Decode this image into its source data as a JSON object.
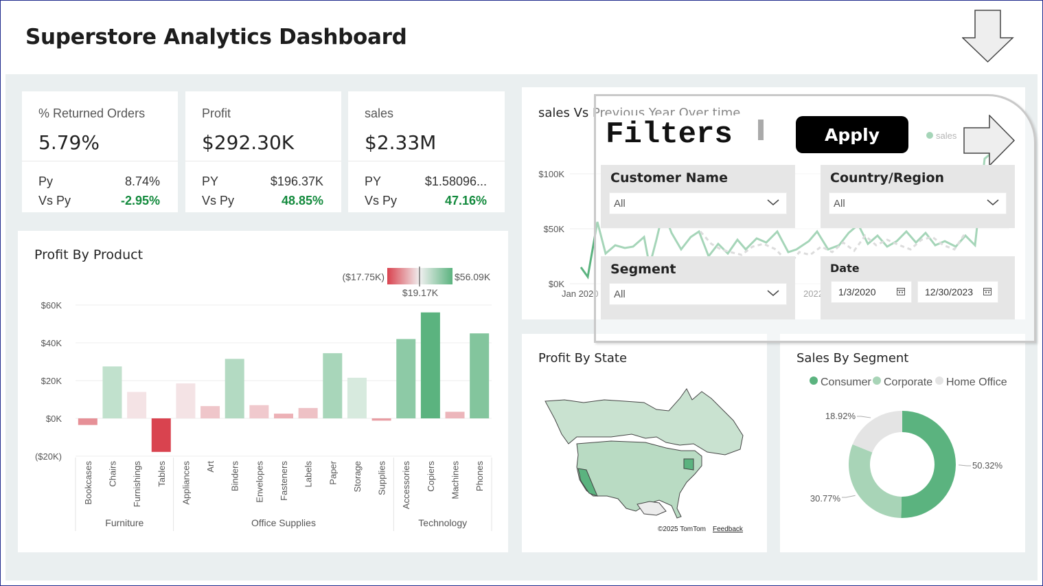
{
  "header": {
    "title": "Superstore Analytics Dashboard"
  },
  "kpis": [
    {
      "title": "% Returned Orders",
      "value": "5.79%",
      "py_label": "Py",
      "py_value": "8.74%",
      "vs_label": "Vs Py",
      "vs_value": "-2.95%"
    },
    {
      "title": "Profit",
      "value": "$292.30K",
      "py_label": "PY",
      "py_value": "$196.37K",
      "vs_label": "Vs Py",
      "vs_value": "48.85%"
    },
    {
      "title": "sales",
      "value": "$2.33M",
      "py_label": "PY",
      "py_value": "$1.58096...",
      "vs_label": "Vs Py",
      "vs_value": "47.16%"
    }
  ],
  "profit_by_product": {
    "title": "Profit By Product",
    "gradient_legend": {
      "min": "($17.75K)",
      "mid": "$19.17K",
      "max": "$56.09K"
    }
  },
  "sales_vs_py": {
    "title": "sales Vs Previous Year Over time",
    "legend_label": "sales",
    "y_ticks": [
      "$100K",
      "$50K",
      "$0K"
    ],
    "x_ticks": [
      "Jan 2020",
      "2022"
    ]
  },
  "profit_by_state": {
    "title": "Profit By State",
    "attribution": "©2025 TomTom",
    "feedback_label": "Feedback"
  },
  "sales_by_segment": {
    "title": "Sales By Segment"
  },
  "filters_overlay": {
    "title": "Filters",
    "apply_label": "Apply",
    "customer_name": {
      "label": "Customer Name",
      "value": "All"
    },
    "country_region": {
      "label": "Country/Region",
      "value": "All"
    },
    "segment": {
      "label": "Segment",
      "value": "All"
    },
    "date": {
      "label": "Date",
      "start": "1/3/2020",
      "end": "12/30/2023"
    }
  },
  "icons": {
    "top_right": "arrow-down-icon",
    "overlay_close": "arrow-right-icon"
  },
  "colors": {
    "positive": "#138a3d",
    "accent_green": "#5bb37f",
    "negative_red": "#d9434f"
  },
  "chart_data": [
    {
      "type": "bar",
      "title": "Profit By Product",
      "group_labels": [
        "Furniture",
        "Office Supplies",
        "Technology"
      ],
      "groups": [
        {
          "name": "Furniture",
          "categories": [
            "Bookcases",
            "Chairs",
            "Furnishings",
            "Tables"
          ]
        },
        {
          "name": "Office Supplies",
          "categories": [
            "Appliances",
            "Art",
            "Binders",
            "Envelopes",
            "Fasteners",
            "Labels",
            "Paper",
            "Storage",
            "Supplies"
          ]
        },
        {
          "name": "Technology",
          "categories": [
            "Accessories",
            "Copiers",
            "Machines",
            "Phones"
          ]
        }
      ],
      "categories": [
        "Bookcases",
        "Chairs",
        "Furnishings",
        "Tables",
        "Appliances",
        "Art",
        "Binders",
        "Envelopes",
        "Fasteners",
        "Labels",
        "Paper",
        "Storage",
        "Supplies",
        "Accessories",
        "Copiers",
        "Machines",
        "Phones"
      ],
      "values": [
        -3.5,
        27.5,
        14,
        -17.75,
        18.5,
        6.5,
        31.5,
        7,
        2.5,
        5.5,
        34.5,
        21.5,
        -1.2,
        42,
        56.09,
        3.5,
        45
      ],
      "y_ticks": [
        "$60K",
        "$40K",
        "$20K",
        "$0K",
        "($20K)"
      ],
      "ylim": [
        -20,
        60
      ],
      "color_scale": {
        "min": -17.75,
        "mid": 19.17,
        "max": 56.09
      }
    },
    {
      "type": "pie",
      "title": "Sales By Segment",
      "categories": [
        "Consumer",
        "Corporate",
        "Home Office"
      ],
      "values": [
        50.32,
        30.77,
        18.92
      ],
      "labels": [
        "50.32%",
        "30.77%",
        "18.92%"
      ],
      "colors": [
        "#5bb37f",
        "#a8d4b7",
        "#e4e4e4"
      ],
      "legend": "top"
    }
  ]
}
